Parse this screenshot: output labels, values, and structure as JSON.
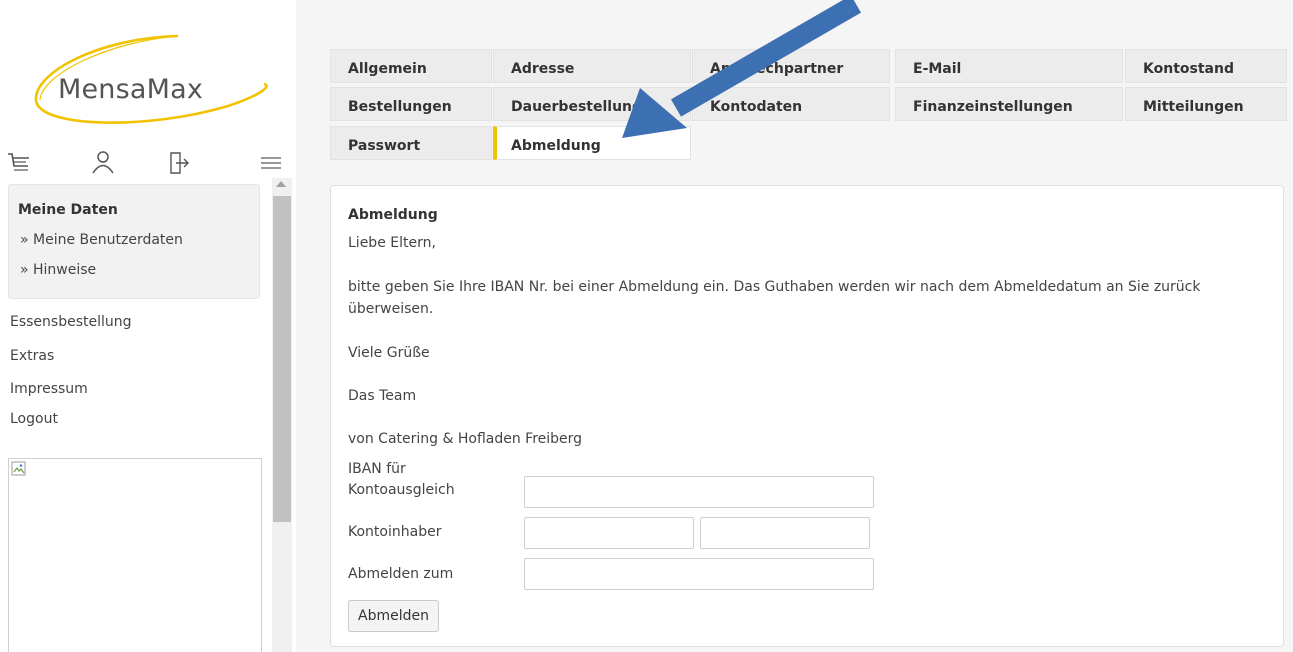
{
  "logo": {
    "text": "MensaMax",
    "swoosh_color": "#f2c200"
  },
  "iconbar": [
    {
      "icon": "cart-icon"
    },
    {
      "icon": "user-icon"
    },
    {
      "icon": "logout-icon"
    },
    {
      "icon": "hamburger-menu-icon"
    }
  ],
  "sidebar": {
    "panel_title": "Meine Daten",
    "panel_links": [
      "» Meine Benutzerdaten",
      "» Hinweise"
    ],
    "links": [
      "Essensbestellung",
      "Extras",
      "Impressum",
      "Logout"
    ]
  },
  "tabs": [
    [
      "Allgemein",
      "Adresse",
      "Ansprechpartner",
      "E-Mail",
      "Kontostand"
    ],
    [
      "Bestellungen",
      "Dauerbestellung",
      "Kontodaten",
      "Finanzeinstellungen",
      "Mitteilungen"
    ],
    [
      "Passwort",
      "Abmeldung"
    ]
  ],
  "active_tab": "Abmeldung",
  "accent_color": "#f2c200",
  "content": {
    "title": "Abmeldung",
    "greeting": "Liebe Eltern,",
    "paragraph_line1": "bitte geben Sie Ihre IBAN Nr. bei einer Abmeldung ein. Das Guthaben werden wir nach dem Abmeldedatum an Sie zurück",
    "paragraph_line2": "überweisen.",
    "regards": "Viele Grüße",
    "team": "Das Team",
    "company": "von Catering & Hofladen Freiberg",
    "iban_label_line1": "IBAN für",
    "iban_label_line2": "Kontoausgleich",
    "iban_value": "",
    "holder_label": "Kontoinhaber",
    "holder_first_value": "",
    "holder_last_value": "",
    "date_label": "Abmelden zum",
    "date_value": "",
    "submit_label": "Abmelden"
  },
  "annotation_arrow_color": "#3d6fb3"
}
